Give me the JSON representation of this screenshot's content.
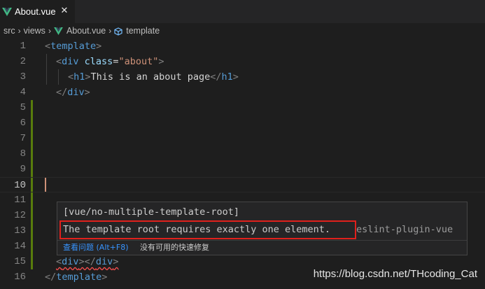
{
  "tab": {
    "label": "About.vue",
    "close_glyph": "✕",
    "icon": "vue-icon",
    "vue_color": "#41b883"
  },
  "breadcrumb": {
    "parts": [
      "src",
      "views",
      "About.vue",
      "template"
    ],
    "separator": "›",
    "icons": {
      "file": "vue-icon",
      "symbol": "cube-icon"
    }
  },
  "editor": {
    "line_numbers": [
      "1",
      "2",
      "3",
      "4",
      "5",
      "6",
      "7",
      "8",
      "9",
      "10",
      "11",
      "12",
      "13",
      "14",
      "15",
      "16"
    ],
    "current_line": "10",
    "code": {
      "l1": {
        "open": "<",
        "tag": "template",
        "close": ">"
      },
      "l2": {
        "open": "<",
        "tag": "div",
        "attr": "class",
        "eq": "=",
        "value": "\"about\"",
        "close": ">"
      },
      "l3": {
        "open": "<",
        "tag": "h1",
        "close": ">",
        "text": "This is an about page",
        "end_open": "</",
        "end_tag": "h1",
        "end_close": ">"
      },
      "l4": {
        "open": "</",
        "tag": "div",
        "close": ">"
      },
      "l15": {
        "open": "<",
        "tag": "div",
        "mid": "></",
        "tag2": "div",
        "close": ">"
      },
      "l16": {
        "open": "</",
        "tag": "template",
        "close": ">"
      }
    },
    "gutter_modified_color": "#587c0c",
    "error_color": "#f14c4c"
  },
  "hover": {
    "rule": "[vue/no-multiple-template-root]",
    "message": "The template root requires exactly one element.",
    "source": "eslint-plugin-vue",
    "peek_action": "查看问题 (Alt+F8)",
    "no_quick_fix": "没有可用的快速修复",
    "highlight_color": "#e0201c",
    "link_color": "#3794ff"
  },
  "watermark": "https://blog.csdn.net/THcoding_Cat"
}
